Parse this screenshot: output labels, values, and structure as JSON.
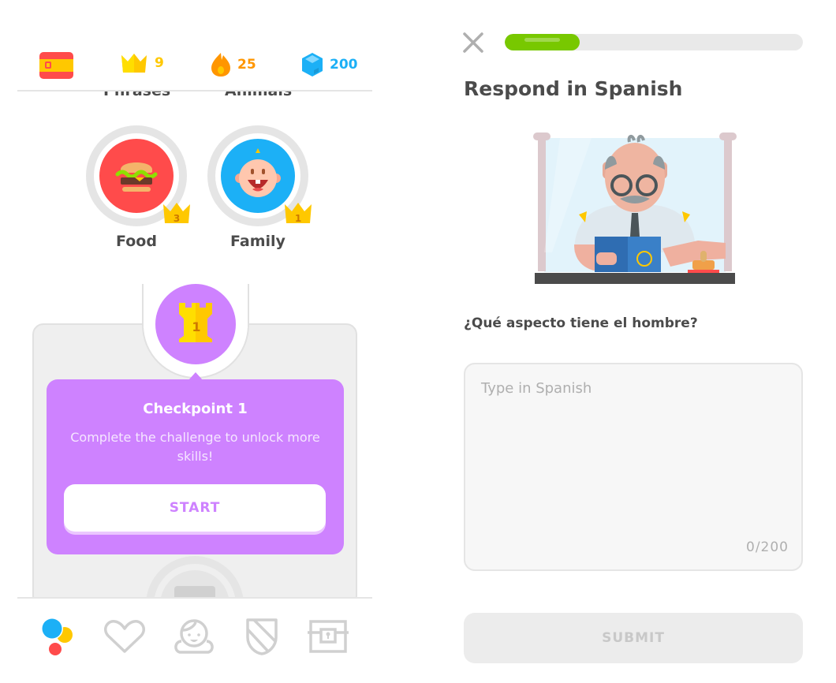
{
  "left_panel": {
    "stats": {
      "course_flag": "spain-flag-icon",
      "crowns": {
        "icon": "crown-icon",
        "value": "9",
        "color": "#ffc800"
      },
      "streak": {
        "icon": "flame-icon",
        "value": "25",
        "color": "#ff9600"
      },
      "gems": {
        "icon": "gem-icon",
        "value": "200",
        "color": "#1cb0f6"
      }
    },
    "clipped_skill_labels": [
      "Phrases",
      "Animals"
    ],
    "skills": [
      {
        "label": "Food",
        "icon": "burger-icon",
        "crown_level": "3",
        "color": "#ff4b4b"
      },
      {
        "label": "Family",
        "icon": "baby-face-icon",
        "crown_level": "1",
        "color": "#1cb0f6"
      }
    ],
    "checkpoint": {
      "number": "1",
      "title": "Checkpoint 1",
      "description": "Complete the challenge to unlock more skills!",
      "button_label": "START",
      "color": "#ce82ff"
    },
    "bottom_nav": [
      {
        "name": "learn",
        "icon": "learn-dots-icon",
        "active": true
      },
      {
        "name": "hearts",
        "icon": "heart-icon",
        "active": false
      },
      {
        "name": "profile",
        "icon": "profile-face-icon",
        "active": false
      },
      {
        "name": "leagues",
        "icon": "shield-icon",
        "active": false
      },
      {
        "name": "shop",
        "icon": "treasure-chest-icon",
        "active": false
      }
    ]
  },
  "right_panel": {
    "progress": 0.25,
    "progress_color": "#78c800",
    "title": "Respond in Spanish",
    "illustration": "passport-officer-illustration",
    "question": "¿Qué aspecto tiene el hombre?",
    "answer": {
      "value": "",
      "placeholder": "Type in Spanish",
      "counter": "0/200"
    },
    "submit_label": "SUBMIT"
  }
}
